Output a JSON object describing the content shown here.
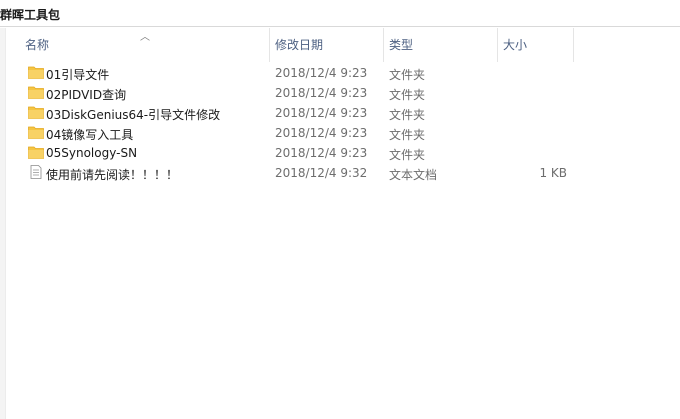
{
  "breadcrumb": {
    "title": "群晖工具包"
  },
  "columns": {
    "name": "名称",
    "date": "修改日期",
    "type": "类型",
    "size": "大小",
    "sort_icon": "sort-ascending-icon"
  },
  "files": [
    {
      "name": "01引导文件",
      "date": "2018/12/4 9:23",
      "type": "文件夹",
      "size": "",
      "icon": "folder-icon"
    },
    {
      "name": "02PIDVID查询",
      "date": "2018/12/4 9:23",
      "type": "文件夹",
      "size": "",
      "icon": "folder-icon"
    },
    {
      "name": "03DiskGenius64-引导文件修改",
      "date": "2018/12/4 9:23",
      "type": "文件夹",
      "size": "",
      "icon": "folder-icon"
    },
    {
      "name": "04镜像写入工具",
      "date": "2018/12/4 9:23",
      "type": "文件夹",
      "size": "",
      "icon": "folder-icon"
    },
    {
      "name": "05Synology-SN",
      "date": "2018/12/4 9:23",
      "type": "文件夹",
      "size": "",
      "icon": "folder-icon"
    },
    {
      "name": "使用前请先阅读！！！！",
      "date": "2018/12/4 9:32",
      "type": "文本文档",
      "size": "1 KB",
      "icon": "text-document-icon"
    }
  ],
  "colors": {
    "folder": "#f5c542",
    "folder_dark": "#e3a821",
    "header_text": "#4d6082",
    "meta_text": "#6d6d6d"
  }
}
